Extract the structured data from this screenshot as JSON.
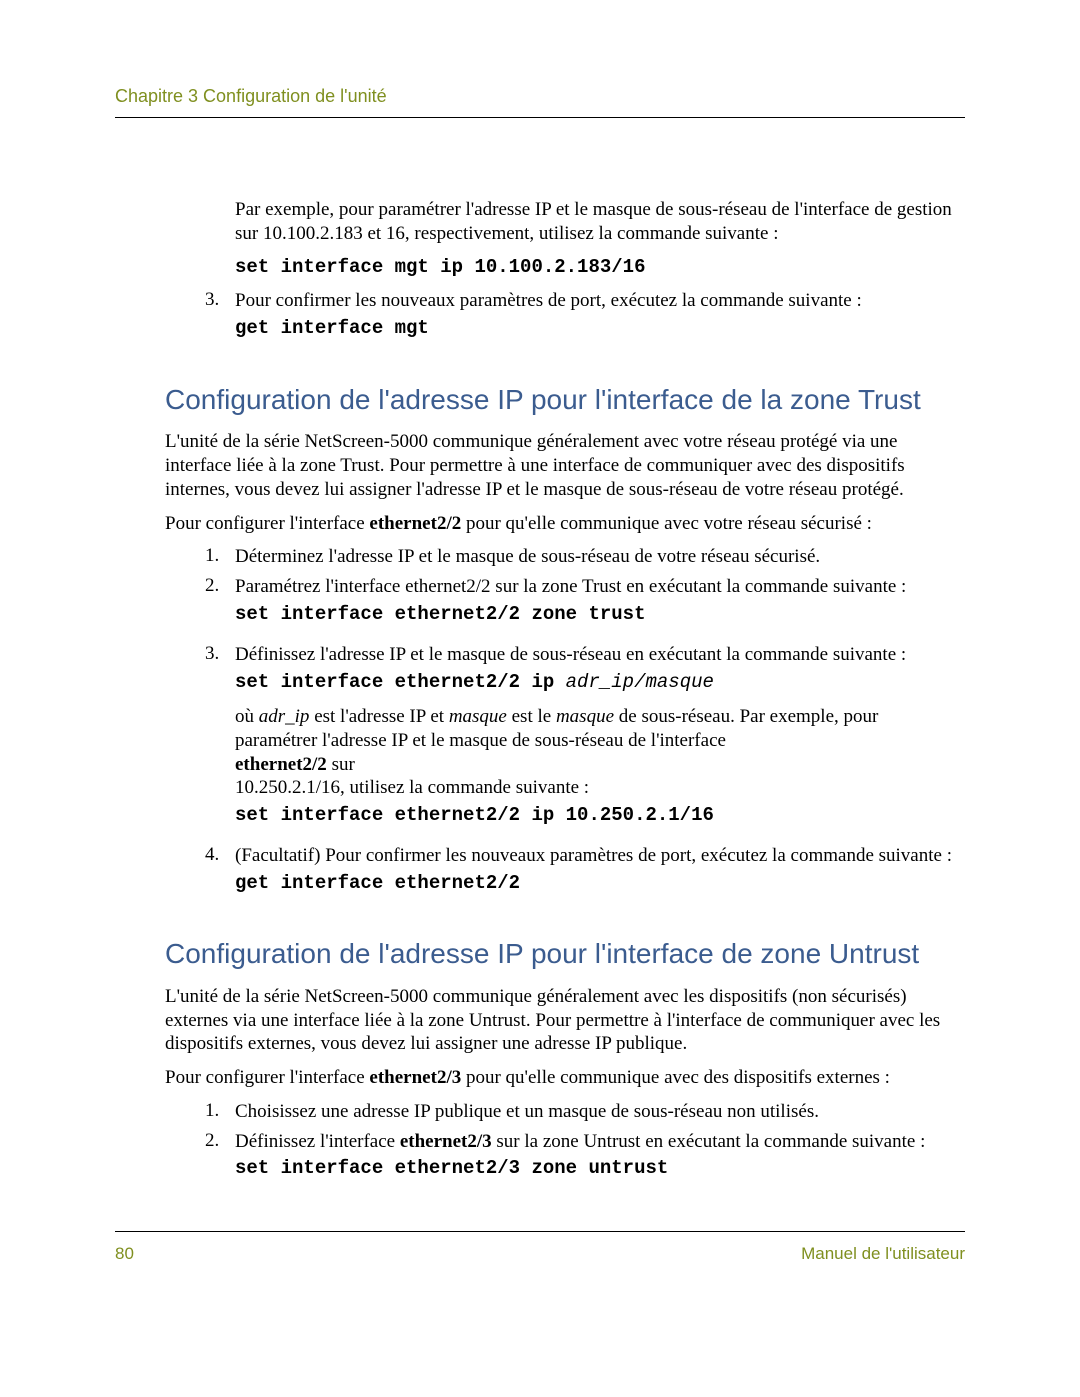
{
  "header": {
    "chapter": "Chapitre 3 Configuration de l'unité"
  },
  "top_example": {
    "intro": "Par exemple, pour paramétrer l'adresse IP et le masque de sous-réseau de l'interface de gestion sur 10.100.2.183 et 16, respectivement, utilisez la commande suivante :",
    "cmd1": "set interface mgt ip 10.100.2.183/16",
    "item3_num": "3.",
    "item3_text": "Pour confirmer les nouveaux paramètres de port, exécutez la commande suivante :",
    "cmd2": "get interface mgt"
  },
  "trust": {
    "heading": "Configuration de l'adresse IP pour l'interface de la zone Trust",
    "p1": "L'unité de la série NetScreen-5000 communique généralement avec votre réseau protégé via une interface liée à la zone Trust. Pour permettre à une interface de communiquer avec des dispositifs internes, vous devez lui assigner l'adresse IP et le masque de sous-réseau de votre réseau protégé.",
    "p2_a": "Pour configurer l'interface ",
    "p2_b": "ethernet2/2",
    "p2_c": " pour qu'elle communique avec votre réseau sécurisé :",
    "item1_num": "1.",
    "item1": "Déterminez l'adresse IP et le masque de sous-réseau de votre réseau sécurisé.",
    "item2_num": "2.",
    "item2": "Paramétrez l'interface ethernet2/2 sur la zone Trust en exécutant la commande suivante :",
    "cmd_a": "set interface ethernet2/2 zone trust",
    "item3_num": "3.",
    "item3": "Définissez l'adresse IP et le masque de sous-réseau en exécutant la commande suivante :",
    "cmd_b_1": "set interface ethernet2/2 ip ",
    "cmd_b_2": "adr_ip",
    "cmd_b_3": "/",
    "cmd_b_4": "masque",
    "note_a": "où ",
    "note_b": "adr_ip",
    "note_c": " est l'adresse IP et ",
    "note_d": "masque",
    "note_e": " est le ",
    "note_f": "masque",
    "note_g": " de sous-réseau. Par exemple, pour paramétrer l'adresse IP et le masque de sous-réseau de l'interface ",
    "note_h": "ethernet2/2",
    "note_i": " sur",
    "note_j": "10.250.2.1/16, utilisez la commande suivante :",
    "cmd_c": "set interface ethernet2/2 ip 10.250.2.1/16",
    "item4_num": "4.",
    "item4": "(Facultatif) Pour confirmer les nouveaux paramètres de port, exécutez la commande suivante :",
    "cmd_d": "get interface ethernet2/2"
  },
  "untrust": {
    "heading": "Configuration de l'adresse IP pour l'interface de zone Untrust",
    "p1": "L'unité de la série NetScreen-5000 communique généralement avec les dispositifs (non sécurisés) externes via une interface liée à la zone Untrust. Pour permettre à l'interface de communiquer avec les dispositifs externes, vous devez lui assigner une adresse IP publique.",
    "p2_a": "Pour configurer l'interface ",
    "p2_b": "ethernet2/3",
    "p2_c": " pour qu'elle communique avec des dispositifs externes :",
    "item1_num": "1.",
    "item1": "Choisissez une adresse IP publique et un masque de sous-réseau non utilisés.",
    "item2_num": "2.",
    "item2_a": "Définissez l'interface ",
    "item2_b": "ethernet2/3",
    "item2_c": " sur la zone Untrust en exécutant la commande suivante :",
    "cmd_a": "set interface ethernet2/3 zone untrust"
  },
  "footer": {
    "page": "80",
    "manual": "Manuel de l'utilisateur"
  }
}
